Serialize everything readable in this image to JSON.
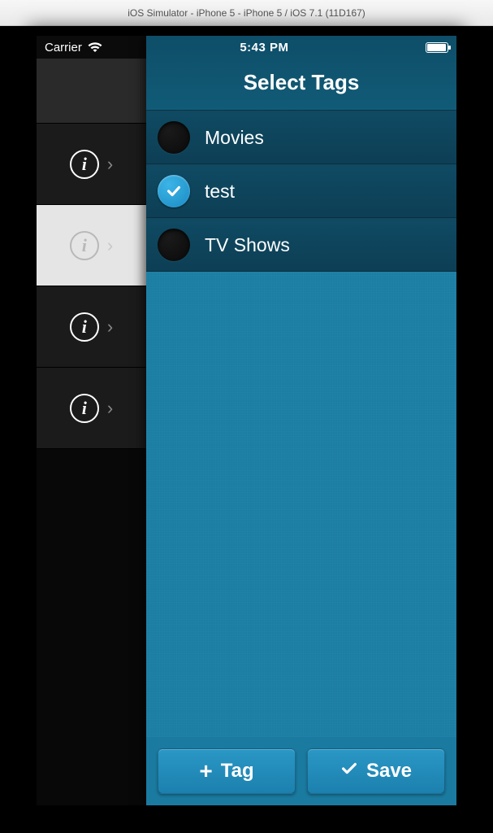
{
  "mac_title": "iOS Simulator - iPhone 5 - iPhone 5 / iOS 7.1 (11D167)",
  "status": {
    "carrier": "Carrier",
    "time": "5:43 PM"
  },
  "header": {
    "title": "Select Tags"
  },
  "tags": [
    {
      "label": "Movies",
      "checked": false
    },
    {
      "label": "test",
      "checked": true
    },
    {
      "label": "TV Shows",
      "checked": false
    }
  ],
  "sidebar_rows": [
    {
      "selected": false
    },
    {
      "selected": true
    },
    {
      "selected": false
    },
    {
      "selected": false
    }
  ],
  "footer": {
    "add_label": "Tag",
    "save_label": "Save"
  }
}
